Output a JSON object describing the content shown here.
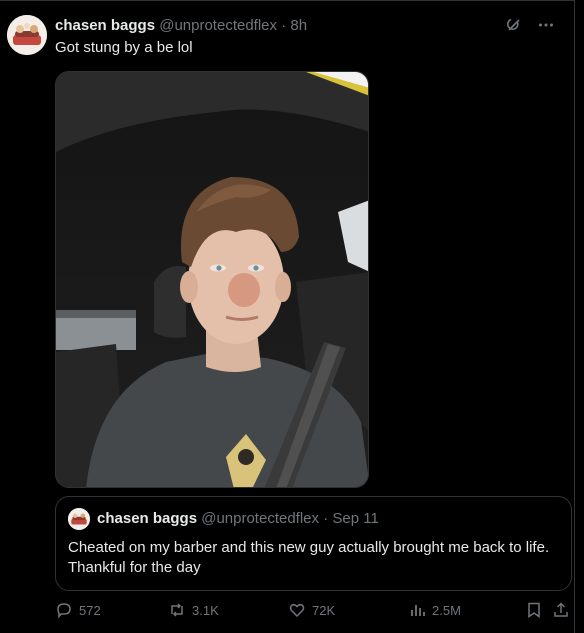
{
  "tweet": {
    "author_name": "chasen baggs",
    "author_handle": "@unprotectedflex",
    "separator": "·",
    "time": "8h",
    "text": "Got stung by a be lol"
  },
  "quote": {
    "author_name": "chasen baggs",
    "author_handle": "@unprotectedflex",
    "separator": "·",
    "date": "Sep 11",
    "text": "Cheated on my barber and this new guy actually brought me back to life. Thankful for the day"
  },
  "actions": {
    "replies": "572",
    "reposts": "3.1K",
    "likes": "72K",
    "views": "2.5M"
  },
  "icons": [
    "grok-icon",
    "more-icon",
    "reply-icon",
    "repost-icon",
    "like-icon",
    "views-icon",
    "bookmark-icon",
    "share-icon"
  ],
  "colors": {
    "background": "#000000",
    "text": "#e7e9ea",
    "muted": "#71767b",
    "border": "#2f3336"
  }
}
